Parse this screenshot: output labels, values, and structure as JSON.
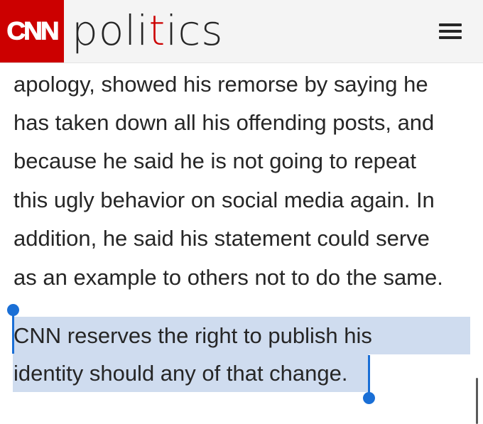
{
  "header": {
    "logo_text": "CNN",
    "section_prefix": "poli",
    "section_accent": "t",
    "section_suffix": "ics",
    "brand_color": "#cc0000"
  },
  "article": {
    "lines": [
      "apology, showed his remorse by saying he",
      "has taken down all his offending posts, and",
      "because he said he is not going to repeat",
      "this ugly behavior on social media again. In",
      "addition, he said his statement could serve",
      "as an example to others not to do the same."
    ],
    "selected_lines": [
      "CNN reserves the right to publish his",
      "identity should any of that change."
    ]
  },
  "selection": {
    "highlight_color": "#cfdcef",
    "handle_color": "#1a6fd6"
  },
  "icons": {
    "menu": "hamburger-menu-icon"
  }
}
